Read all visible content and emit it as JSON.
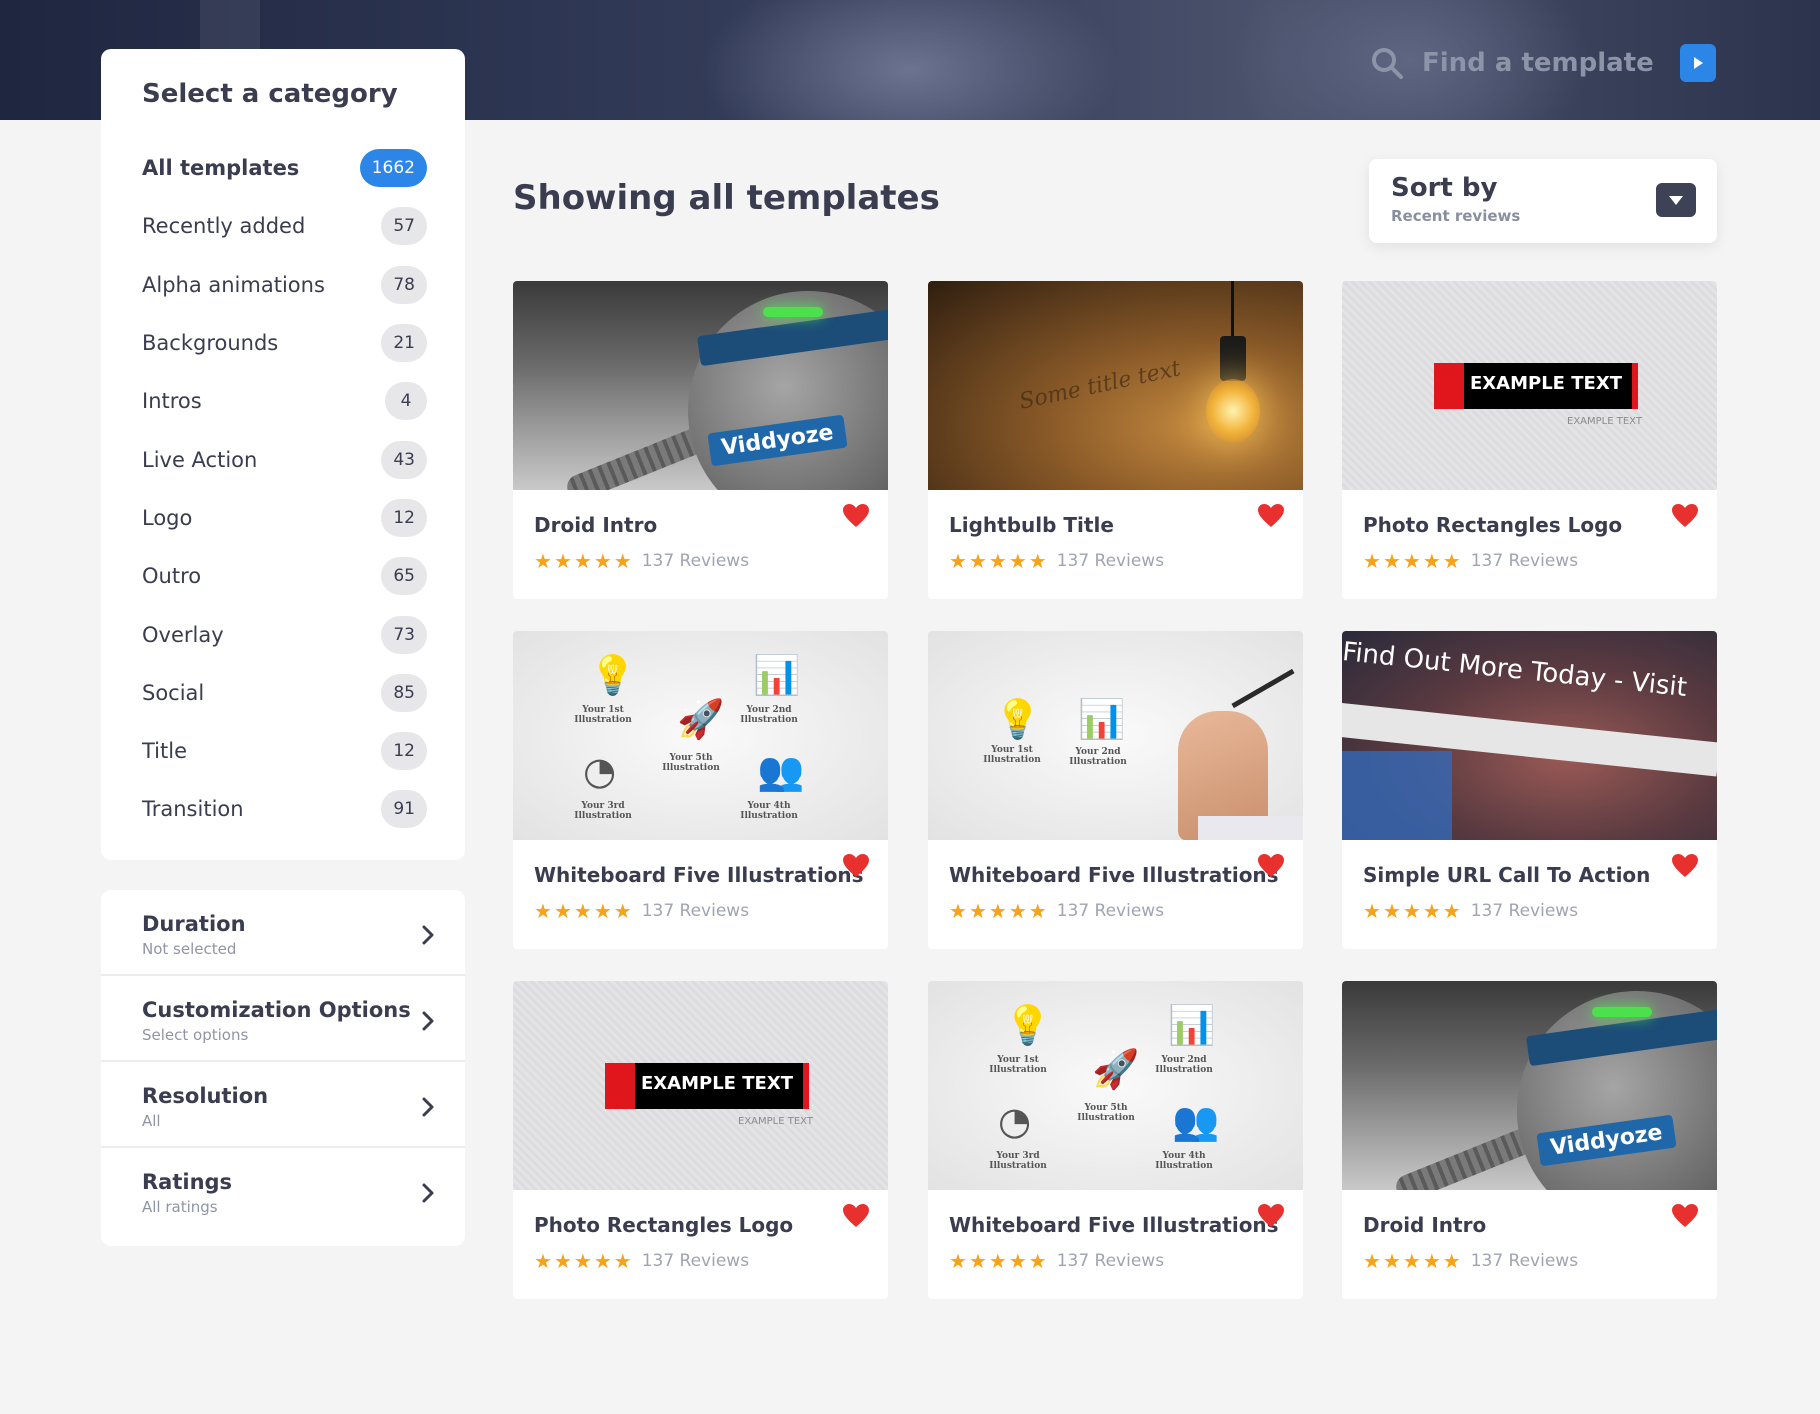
{
  "search": {
    "placeholder": "Find a template"
  },
  "sidebar": {
    "title": "Select a category",
    "categories": [
      {
        "label": "All templates",
        "count": "1662"
      },
      {
        "label": "Recently added",
        "count": "57"
      },
      {
        "label": "Alpha animations",
        "count": "78"
      },
      {
        "label": "Backgrounds",
        "count": "21"
      },
      {
        "label": "Intros",
        "count": "4"
      },
      {
        "label": "Live Action",
        "count": "43"
      },
      {
        "label": "Logo",
        "count": "12"
      },
      {
        "label": "Outro",
        "count": "65"
      },
      {
        "label": "Overlay",
        "count": "73"
      },
      {
        "label": "Social",
        "count": "85"
      },
      {
        "label": "Title",
        "count": "12"
      },
      {
        "label": "Transition",
        "count": "91"
      }
    ]
  },
  "filters": [
    {
      "title": "Duration",
      "sub": "Not selected"
    },
    {
      "title": "Customization Options",
      "sub": "Select options"
    },
    {
      "title": "Resolution",
      "sub": "All"
    },
    {
      "title": "Ratings",
      "sub": "All ratings"
    }
  ],
  "main": {
    "heading": "Showing all templates"
  },
  "sort": {
    "label": "Sort by",
    "value": "Recent reviews"
  },
  "thumb_text": {
    "lightbulb": "Some title text",
    "rect_main": "EXAMPLE TEXT",
    "rect_sub": "EXAMPLE TEXT",
    "droid_logo": "Viddyoze",
    "url_text": "Find Out More Today - Visit",
    "wb_1": "Your 1st Illustration",
    "wb_2": "Your 2nd Illustration",
    "wb_3": "Your 3rd Illustration",
    "wb_4": "Your 4th Illustration",
    "wb_5": "Your 5th Illustration"
  },
  "cards": [
    {
      "title": "Droid Intro",
      "reviews": "137 Reviews",
      "rating": 5,
      "thumb": "droid"
    },
    {
      "title": "Lightbulb Title",
      "reviews": "137 Reviews",
      "rating": 5,
      "thumb": "bulb"
    },
    {
      "title": "Photo Rectangles Logo",
      "reviews": "137 Reviews",
      "rating": 5,
      "thumb": "rect"
    },
    {
      "title": "Whiteboard Five Illustrations",
      "reviews": "137 Reviews",
      "rating": 5,
      "thumb": "wb"
    },
    {
      "title": "Whiteboard Five Illustrations",
      "reviews": "137 Reviews",
      "rating": 5,
      "thumb": "wb-hand"
    },
    {
      "title": "Simple URL Call To Action",
      "reviews": "137 Reviews",
      "rating": 5,
      "thumb": "url"
    },
    {
      "title": "Photo Rectangles Logo",
      "reviews": "137 Reviews",
      "rating": 5,
      "thumb": "rect"
    },
    {
      "title": "Whiteboard Five Illustrations",
      "reviews": "137 Reviews",
      "rating": 5,
      "thumb": "wb"
    },
    {
      "title": "Droid Intro",
      "reviews": "137 Reviews",
      "rating": 5,
      "thumb": "droid"
    }
  ],
  "colors": {
    "accent": "#2b86e8",
    "heart": "#e8302e",
    "star": "#f7a21b",
    "text": "#3a3d4f"
  }
}
